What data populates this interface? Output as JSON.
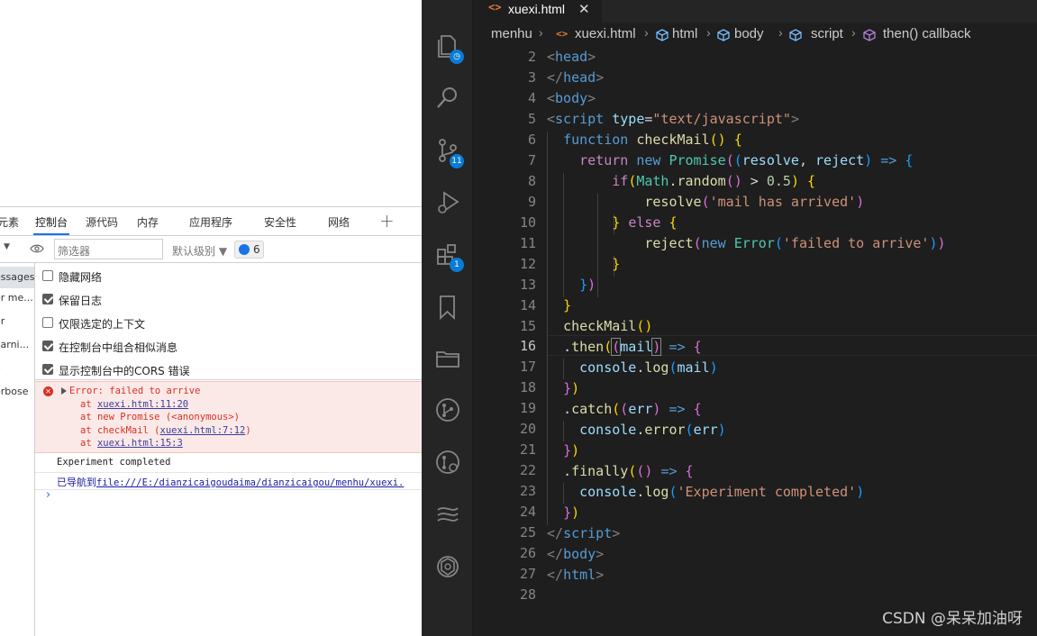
{
  "devtools": {
    "tabs": [
      "元素",
      "控制台",
      "源代码",
      "内存",
      "应用程序",
      "安全性",
      "网络"
    ],
    "active_tab": "控制台",
    "toolbar": {
      "filter_placeholder": "筛选器",
      "level_label": "默认级别 ▼",
      "issues_count": "6"
    },
    "sidebar": {
      "items": [
        "essages",
        "er me...",
        "or",
        "varni...",
        "o",
        "erbose"
      ]
    },
    "settings": [
      {
        "label": "隐藏网络",
        "checked": false
      },
      {
        "label": "保留日志",
        "checked": true
      },
      {
        "label": "仅限选定的上下文",
        "checked": false
      },
      {
        "label": "在控制台中组合相似消息",
        "checked": true
      },
      {
        "label": "显示控制台中的CORS 错误",
        "checked": true
      }
    ],
    "console": {
      "error_title": "Error: failed to arrive",
      "stack": [
        {
          "prefix": "at ",
          "fn": "",
          "link": "xuexi.html:11:20",
          "suffix": ""
        },
        {
          "prefix": "at new Promise (<anonymous>)",
          "fn": "",
          "link": "",
          "suffix": ""
        },
        {
          "prefix": "at checkMail (",
          "fn": "",
          "link": "xuexi.html:7:12",
          "suffix": ")"
        },
        {
          "prefix": "at ",
          "fn": "",
          "link": "xuexi.html:15:3",
          "suffix": ""
        }
      ],
      "log_text": "Experiment completed",
      "nav_prefix": "已导航到",
      "nav_url": "file:///E:/dianzicaigoudaima/dianzicaigou/menhu/xuexi.",
      "prompt": "›"
    }
  },
  "vscode": {
    "tab": {
      "icon": "<>",
      "name": "xuexi.html",
      "close": "✕"
    },
    "breadcrumbs": [
      "menhu",
      "xuexi.html",
      "html",
      "body",
      "script",
      "then() callback"
    ],
    "activity_badges": {
      "source_control": "11",
      "extensions": "1"
    },
    "current_line": 16,
    "line_numbers": [
      "2",
      "3",
      "4",
      "5",
      "6",
      "7",
      "8",
      "9",
      "10",
      "11",
      "12",
      "13",
      "14",
      "15",
      "16",
      "17",
      "18",
      "19",
      "20",
      "21",
      "22",
      "23",
      "24",
      "25",
      "26",
      "27",
      "28"
    ],
    "watermark": "CSDN @呆呆加油呀"
  },
  "colors": {
    "editor_bg": "#1e1e1e",
    "activity_bg": "#252526",
    "badge_blue": "#0a7bd6",
    "error_red": "#d93025",
    "error_bg": "#fbe9e7"
  }
}
